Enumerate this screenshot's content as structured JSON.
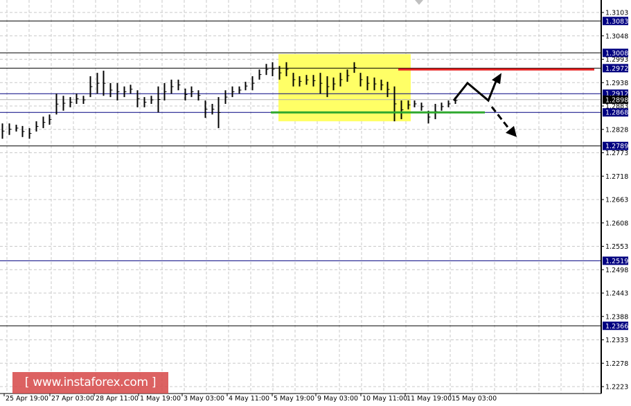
{
  "chart_data": {
    "type": "bar",
    "style": "ohlc-bars",
    "ylim": [
      1.2223,
      1.3103
    ],
    "grid": true,
    "y_ticks": [
      "1.3103",
      "1.3048",
      "1.2993",
      "1.2938",
      "1.2883",
      "1.2828",
      "1.2773",
      "1.2718",
      "1.2663",
      "1.2608",
      "1.2553",
      "1.2498",
      "1.2443",
      "1.2388",
      "1.2333",
      "1.2278",
      "1.2223"
    ],
    "x_ticks": [
      "25 Apr 19:00",
      "27 Apr 03:00",
      "28 Apr 11:00",
      "1 May 19:00",
      "3 May 03:00",
      "4 May 11:00",
      "5 May 19:00",
      "9 May 03:00",
      "10 May 11:00",
      "11 May 19:00",
      "15 May 03:00"
    ],
    "current_price": {
      "label": "1.2898",
      "value": 1.2898,
      "color": "#000000"
    },
    "levels": [
      {
        "label": "1.3083",
        "value": 1.3083,
        "color": "#000000"
      },
      {
        "label": "1.3008",
        "value": 1.3008,
        "color": "#000000"
      },
      {
        "label": "1.2972",
        "value": 1.2972,
        "color": "#000000"
      },
      {
        "label": "1.2912",
        "value": 1.2912,
        "color": "#000080"
      },
      {
        "label": "1.2868",
        "value": 1.2868,
        "color": "#000080"
      },
      {
        "label": "1.2789",
        "value": 1.2789,
        "color": "#000000"
      },
      {
        "label": "1.2519",
        "value": 1.2519,
        "color": "#000080"
      },
      {
        "label": "1.2366",
        "value": 1.2366,
        "color": "#000000"
      }
    ],
    "label_bg": "#000080",
    "consolidation_zone": {
      "high": 1.3005,
      "low": 1.2847,
      "color": "#ffff66"
    },
    "resistance_line": {
      "value": 1.2969,
      "color": "#e82020"
    },
    "support_line": {
      "value": 1.2868,
      "color": "#2ea82e"
    },
    "bars": [
      [
        1.2842,
        1.2806
      ],
      [
        1.2842,
        1.2815
      ],
      [
        1.2839,
        1.2823
      ],
      [
        1.2836,
        1.281
      ],
      [
        1.2831,
        1.2806
      ],
      [
        1.2847,
        1.2823
      ],
      [
        1.2858,
        1.2831
      ],
      [
        1.2863,
        1.2839
      ],
      [
        1.2912,
        1.2863
      ],
      [
        1.2907,
        1.2872
      ],
      [
        1.2904,
        1.288
      ],
      [
        1.2912,
        1.2888
      ],
      [
        1.2907,
        1.2888
      ],
      [
        1.2953,
        1.2904
      ],
      [
        1.2961,
        1.2912
      ],
      [
        1.2966,
        1.2907
      ],
      [
        1.2937,
        1.2904
      ],
      [
        1.2937,
        1.2896
      ],
      [
        1.2929,
        1.2904
      ],
      [
        1.2933,
        1.2912
      ],
      [
        1.292,
        1.288
      ],
      [
        1.2904,
        1.288
      ],
      [
        1.2907,
        1.2888
      ],
      [
        1.2929,
        1.2868
      ],
      [
        1.2937,
        1.2896
      ],
      [
        1.2945,
        1.2912
      ],
      [
        1.2945,
        1.292
      ],
      [
        1.2924,
        1.2896
      ],
      [
        1.2929,
        1.2904
      ],
      [
        1.292,
        1.2896
      ],
      [
        1.2896,
        1.2855
      ],
      [
        1.2888,
        1.2863
      ],
      [
        1.2904,
        1.2831
      ],
      [
        1.292,
        1.2888
      ],
      [
        1.2929,
        1.2904
      ],
      [
        1.2929,
        1.2912
      ],
      [
        1.294,
        1.292
      ],
      [
        1.2953,
        1.292
      ],
      [
        1.2969,
        1.2945
      ],
      [
        1.2982,
        1.2956
      ],
      [
        1.2986,
        1.2953
      ],
      [
        1.2977,
        1.2945
      ],
      [
        1.2986,
        1.2953
      ],
      [
        1.2961,
        1.2929
      ],
      [
        1.2953,
        1.2929
      ],
      [
        1.2956,
        1.2933
      ],
      [
        1.2956,
        1.2929
      ],
      [
        1.2961,
        1.2912
      ],
      [
        1.2953,
        1.2904
      ],
      [
        1.295,
        1.292
      ],
      [
        1.2961,
        1.2929
      ],
      [
        1.2969,
        1.294
      ],
      [
        1.2986,
        1.2961
      ],
      [
        1.2961,
        1.2929
      ],
      [
        1.2953,
        1.292
      ],
      [
        1.295,
        1.292
      ],
      [
        1.2945,
        1.292
      ],
      [
        1.294,
        1.2904
      ],
      [
        1.2929,
        1.2847
      ],
      [
        1.2896,
        1.2852
      ],
      [
        1.2896,
        1.2875
      ],
      [
        1.2896,
        1.288
      ],
      [
        1.2891,
        1.2872
      ],
      [
        1.2872,
        1.2842
      ],
      [
        1.2888,
        1.2852
      ],
      [
        1.2891,
        1.2872
      ],
      [
        1.2896,
        1.288
      ],
      [
        1.2904,
        1.2888
      ]
    ],
    "forecast": {
      "up_path": [
        1.2896,
        1.2937,
        1.2896,
        1.2941
      ],
      "down_path": [
        1.2881,
        1.281
      ],
      "color": "#000000"
    }
  },
  "watermark": {
    "text": "[ www.instaforex.com ]"
  }
}
